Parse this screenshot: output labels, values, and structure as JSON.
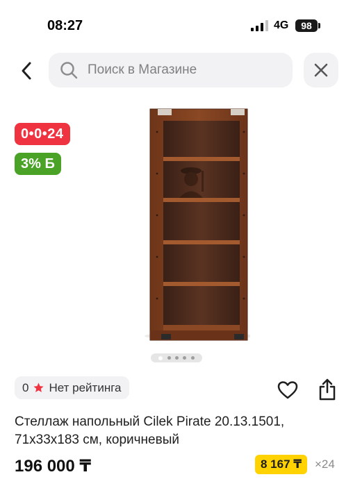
{
  "status_bar": {
    "time": "08:27",
    "network": "4G",
    "battery": "98"
  },
  "search": {
    "placeholder": "Поиск в Магазине",
    "value": ""
  },
  "product": {
    "image_alt": "Стеллаж Pirate",
    "timer_badge": "0•0•24",
    "bonus_badge": "3% Б",
    "gallery_pages": 5,
    "gallery_active": 0,
    "rating_count": "0",
    "rating_text": "Нет рейтинга",
    "title": "Стеллаж напольный Cilek Pirate 20.13.1501, 71x33x183 см, коричневый",
    "price": "196 000 ₸",
    "installment_price": "8 167 ₸",
    "installment_months": "×24"
  },
  "colors": {
    "timer_badge": "#ef3340",
    "bonus_badge": "#4aa227",
    "installment": "#ffd200",
    "rating_star": "#ef3340"
  },
  "icons": {
    "back": "chevron-left-icon",
    "search": "magnifier-icon",
    "clear": "close-icon",
    "star": "star-icon",
    "favorite": "heart-icon",
    "share": "share-icon"
  }
}
